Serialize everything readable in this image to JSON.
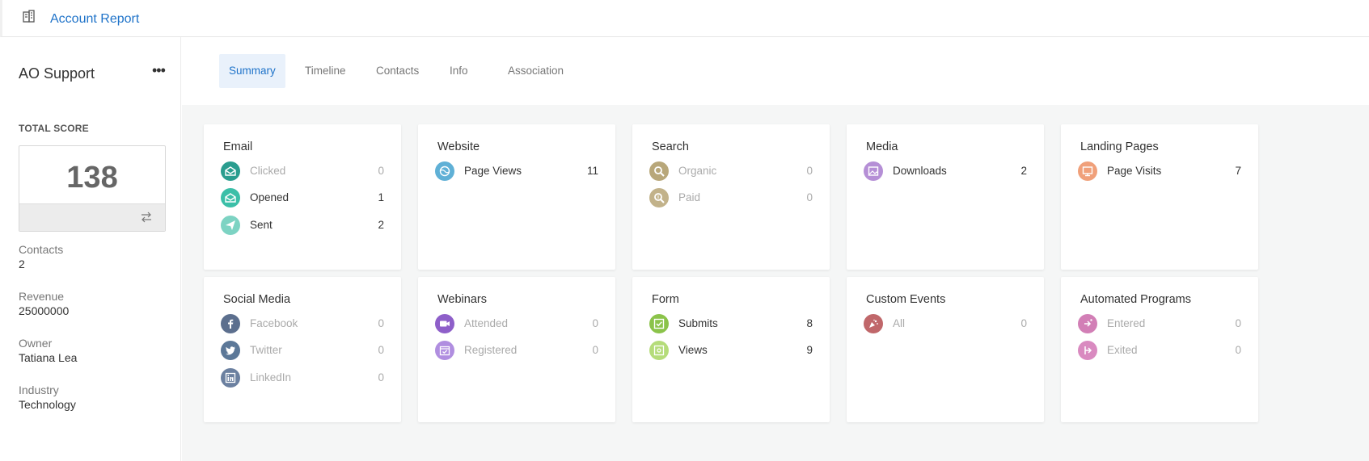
{
  "header": {
    "title": "Account Report",
    "icon": "building-icon"
  },
  "sidebar": {
    "account_name": "AO Support",
    "more_icon": "more-horizontal-icon",
    "total_score_label": "TOTAL SCORE",
    "total_score": "138",
    "fields": [
      {
        "label": "Contacts",
        "value": "2"
      },
      {
        "label": "Revenue",
        "value": "25000000"
      },
      {
        "label": "Owner",
        "value": "Tatiana Lea"
      },
      {
        "label": "Industry",
        "value": "Technology"
      }
    ]
  },
  "tabs": [
    {
      "label": "Summary",
      "active": true
    },
    {
      "label": "Timeline",
      "active": false
    },
    {
      "label": "Contacts",
      "active": false
    },
    {
      "label": "Info",
      "active": false
    },
    {
      "label": "Association",
      "active": false
    }
  ],
  "cards": [
    {
      "title": "Email",
      "rows": [
        {
          "label": "Clicked",
          "value": "0",
          "icon": "email-open-icon",
          "color": "#2a9d8f"
        },
        {
          "label": "Opened",
          "value": "1",
          "icon": "email-open-icon",
          "color": "#3bbfa8"
        },
        {
          "label": "Sent",
          "value": "2",
          "icon": "paper-plane-icon",
          "color": "#7dd3c3"
        }
      ]
    },
    {
      "title": "Website",
      "rows": [
        {
          "label": "Page Views",
          "value": "11",
          "icon": "globe-icon",
          "color": "#5fb0d6"
        }
      ]
    },
    {
      "title": "Search",
      "rows": [
        {
          "label": "Organic",
          "value": "0",
          "icon": "search-icon",
          "color": "#b8a77a"
        },
        {
          "label": "Paid",
          "value": "0",
          "icon": "search-dollar-icon",
          "color": "#c2b28a"
        }
      ]
    },
    {
      "title": "Media",
      "rows": [
        {
          "label": "Downloads",
          "value": "2",
          "icon": "image-icon",
          "color": "#b58fd6"
        }
      ]
    },
    {
      "title": "Landing Pages",
      "rows": [
        {
          "label": "Page Visits",
          "value": "7",
          "icon": "monitor-icon",
          "color": "#f0a07a"
        }
      ]
    },
    {
      "title": "Social Media",
      "rows": [
        {
          "label": "Facebook",
          "value": "0",
          "icon": "facebook-icon",
          "color": "#5c6f8e"
        },
        {
          "label": "Twitter",
          "value": "0",
          "icon": "twitter-icon",
          "color": "#5c7898"
        },
        {
          "label": "LinkedIn",
          "value": "0",
          "icon": "linkedin-icon",
          "color": "#6b80a0"
        }
      ]
    },
    {
      "title": "Webinars",
      "rows": [
        {
          "label": "Attended",
          "value": "0",
          "icon": "video-camera-icon",
          "color": "#8e5fc9"
        },
        {
          "label": "Registered",
          "value": "0",
          "icon": "calendar-check-icon",
          "color": "#b08ee0"
        }
      ]
    },
    {
      "title": "Form",
      "rows": [
        {
          "label": "Submits",
          "value": "8",
          "icon": "checkbox-icon",
          "color": "#8bc34a"
        },
        {
          "label": "Views",
          "value": "9",
          "icon": "form-view-icon",
          "color": "#b5dc7a"
        }
      ]
    },
    {
      "title": "Custom Events",
      "rows": [
        {
          "label": "All",
          "value": "0",
          "icon": "custom-event-icon",
          "color": "#c0676a"
        }
      ]
    },
    {
      "title": "Automated Programs",
      "rows": [
        {
          "label": "Entered",
          "value": "0",
          "icon": "program-entered-icon",
          "color": "#d27fb6"
        },
        {
          "label": "Exited",
          "value": "0",
          "icon": "program-exited-icon",
          "color": "#d98ac0"
        }
      ]
    }
  ]
}
